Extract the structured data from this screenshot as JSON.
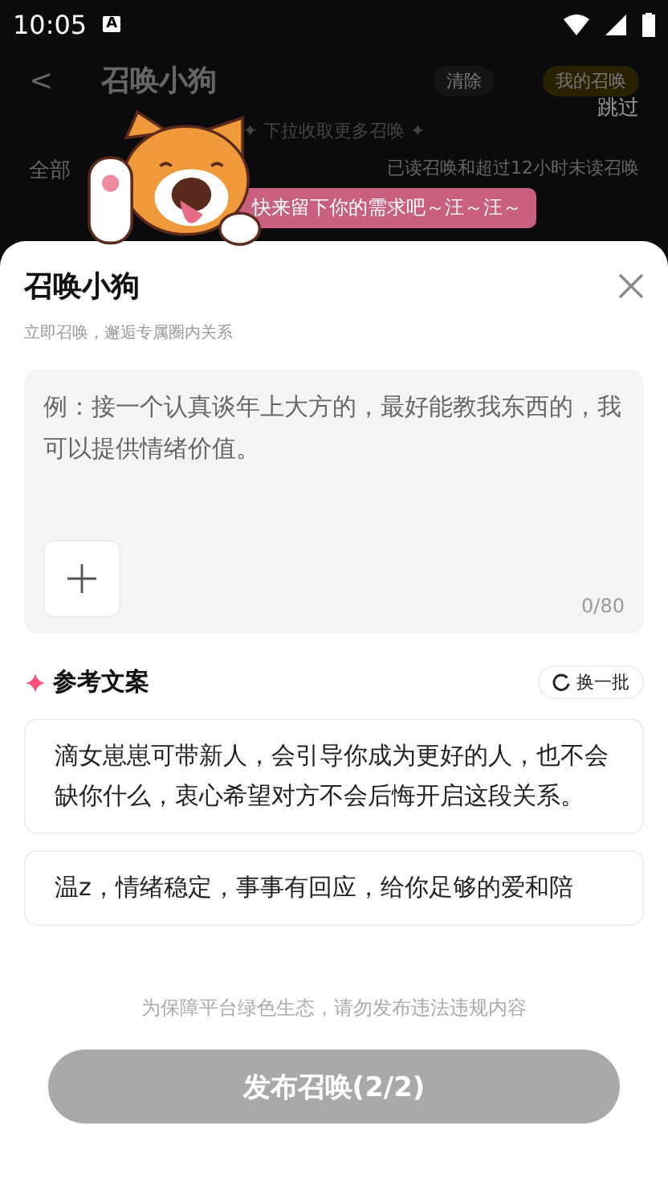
{
  "status_bar": {
    "time": "10:05",
    "badge": "A"
  },
  "background": {
    "back": "<",
    "title": "召唤小狗",
    "clear": "清除",
    "mine": "我的召唤",
    "skip": "跳过",
    "banner": "✦ 下拉收取更多召唤 ✦",
    "filter": "全部",
    "note": "已读召唤和超过12小时未读召唤"
  },
  "bubble": "快来留下你的需求吧～汪～汪～",
  "sheet": {
    "title": "召唤小狗",
    "subtitle": "立即召唤，邂逅专属圈内关系",
    "input": {
      "placeholder": "例：接一个认真谈年上大方的，最好能教我东西的，我可以提供情绪价值。",
      "counter": "0/80"
    },
    "section_title": "参考文案",
    "refresh": "换一批",
    "suggestions": [
      "滴女崽崽可带新人，会引导你成为更好的人，也不会缺你什么，衷心希望对方不会后悔开启这段关系。",
      "温z，情绪稳定，事事有回应，给你足够的爱和陪"
    ],
    "notice": "为保障平台绿色生态，请勿发布违法违规内容",
    "submit": {
      "label": "发布召唤(2/2)",
      "disabled": true
    }
  }
}
